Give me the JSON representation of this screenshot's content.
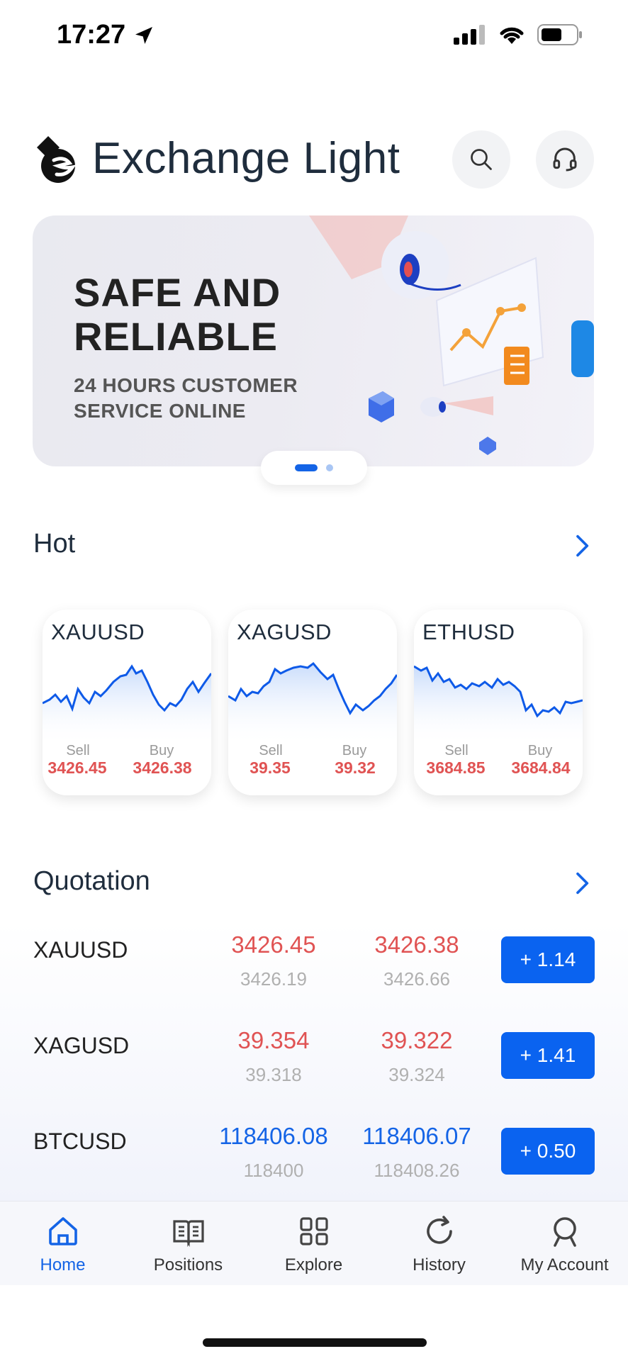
{
  "status_bar": {
    "time": "17:27"
  },
  "header": {
    "title": "Exchange Light"
  },
  "banner": {
    "headline_line1": "SAFE AND",
    "headline_line2": "RELIABLE",
    "sub_line1": "24 HOURS CUSTOMER",
    "sub_line2": "SERVICE ONLINE"
  },
  "hot": {
    "title": "Hot",
    "cards": [
      {
        "symbol": "XAUUSD",
        "sell_label": "Sell",
        "buy_label": "Buy",
        "sell": "3426.45",
        "buy": "3426.38"
      },
      {
        "symbol": "XAGUSD",
        "sell_label": "Sell",
        "buy_label": "Buy",
        "sell": "39.35",
        "buy": "39.32"
      },
      {
        "symbol": "ETHUSD",
        "sell_label": "Sell",
        "buy_label": "Buy",
        "sell": "3684.85",
        "buy": "3684.84"
      }
    ]
  },
  "quotation": {
    "title": "Quotation",
    "rows": [
      {
        "symbol": "XAUUSD",
        "sell": "3426.45",
        "sell_sub": "3426.19",
        "buy": "3426.38",
        "buy_sub": "3426.66",
        "change": "+ 1.14",
        "color": "red"
      },
      {
        "symbol": "XAGUSD",
        "sell": "39.354",
        "sell_sub": "39.318",
        "buy": "39.322",
        "buy_sub": "39.324",
        "change": "+ 1.41",
        "color": "red"
      },
      {
        "symbol": "BTCUSD",
        "sell": "118406.08",
        "sell_sub": "118400",
        "buy": "118406.07",
        "buy_sub": "118408.26",
        "change": "+ 0.50",
        "color": "blue"
      }
    ]
  },
  "nav": {
    "items": [
      {
        "label": "Home",
        "icon": "home-icon",
        "active": true
      },
      {
        "label": "Positions",
        "icon": "book-icon"
      },
      {
        "label": "Explore",
        "icon": "grid-icon"
      },
      {
        "label": "History",
        "icon": "refresh-icon"
      },
      {
        "label": "My Account",
        "icon": "user-icon"
      }
    ]
  },
  "colors": {
    "accent": "#1464e6",
    "price_red": "#e05353",
    "button_blue": "#0a63f0"
  }
}
